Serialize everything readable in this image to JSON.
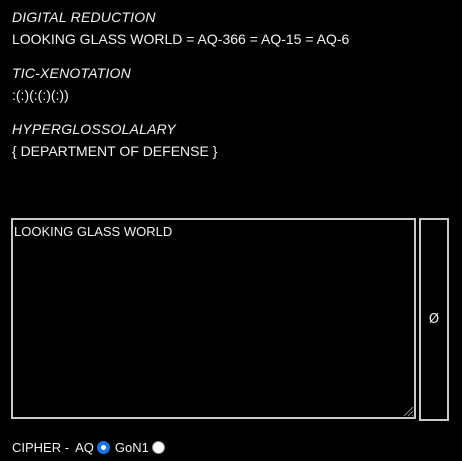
{
  "sections": [
    {
      "heading": "DIGITAL REDUCTION",
      "value": "LOOKING GLASS WORLD = AQ-366 = AQ-15 = AQ-6"
    },
    {
      "heading": "TIC-XENOTATION",
      "value": ":(:)(:(:)(:))"
    },
    {
      "heading": "HYPERGLOSSOLALARY",
      "value": "{ DEPARTMENT OF DEFENSE }"
    }
  ],
  "input": {
    "value": "LOOKING GLASS WORLD"
  },
  "clear_button": {
    "label": "Ø"
  },
  "cipher": {
    "label": "CIPHER -",
    "options": [
      {
        "label": "AQ",
        "selected": true
      },
      {
        "label": "GoN1",
        "selected": false
      }
    ]
  },
  "colors": {
    "background": "#000000",
    "text": "#f2f2f2",
    "border": "#c9c9c9",
    "radio_accent": "#1a73e8"
  }
}
